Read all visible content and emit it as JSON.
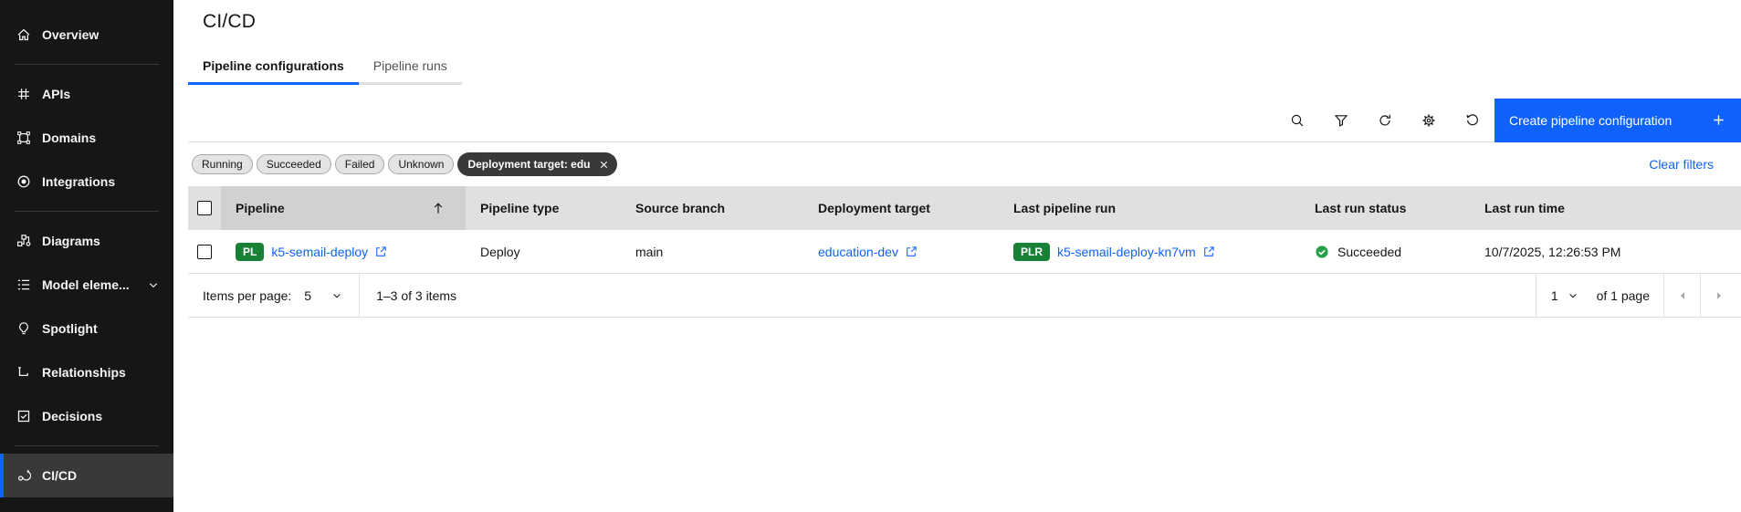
{
  "sidebar": {
    "items": [
      {
        "label": "Overview",
        "icon": "home-icon"
      },
      {
        "label": "APIs",
        "icon": "hash-icon"
      },
      {
        "label": "Domains",
        "icon": "domain-icon"
      },
      {
        "label": "Integrations",
        "icon": "integration-icon"
      },
      {
        "label": "Diagrams",
        "icon": "diagram-icon"
      },
      {
        "label": "Model eleme...",
        "icon": "list-icon",
        "has_chevron": true
      },
      {
        "label": "Spotlight",
        "icon": "lightbulb-icon"
      },
      {
        "label": "Relationships",
        "icon": "relationship-icon"
      },
      {
        "label": "Decisions",
        "icon": "decision-icon"
      },
      {
        "label": "CI/CD",
        "icon": "cicd-icon",
        "selected": true
      }
    ]
  },
  "header": {
    "title": "CI/CD"
  },
  "tabs": [
    {
      "label": "Pipeline configurations",
      "active": true
    },
    {
      "label": "Pipeline runs",
      "active": false
    }
  ],
  "toolbar": {
    "icons": [
      "search-icon",
      "filter-icon",
      "renew-icon",
      "settings-icon",
      "restart-icon"
    ],
    "create_button_label": "Create pipeline configuration"
  },
  "filters": {
    "tags": [
      "Running",
      "Succeeded",
      "Failed",
      "Unknown"
    ],
    "dismissible_tag": "Deployment target: edu",
    "clear_label": "Clear filters"
  },
  "table": {
    "columns": [
      "Pipeline",
      "Pipeline type",
      "Source branch",
      "Deployment target",
      "Last pipeline run",
      "Last run status",
      "Last run time"
    ],
    "sorted_column": "Pipeline",
    "rows": [
      {
        "pipeline_tag": "PL",
        "pipeline_name": "k5-semail-deploy",
        "pipeline_type": "Deploy",
        "source_branch": "main",
        "deployment_target": "education-dev",
        "run_tag": "PLR",
        "last_pipeline_run": "k5-semail-deploy-kn7vm",
        "last_run_status": "Succeeded",
        "last_run_time": "10/7/2025, 12:26:53 PM"
      }
    ]
  },
  "pagination": {
    "items_per_page_label": "Items per page:",
    "items_per_page_value": "5",
    "range_text": "1–3 of 3 items",
    "page_value": "1",
    "page_text": "of 1 page"
  },
  "colors": {
    "accent": "#0f62fe",
    "link": "#0f62fe",
    "tag_green": "#198038",
    "success_green": "#24a148",
    "sidebar_bg": "#161616",
    "sidebar_selected_bg": "#393939",
    "table_header_bg": "#e0e0e0",
    "sorted_column_bg": "#d1d1d1"
  }
}
